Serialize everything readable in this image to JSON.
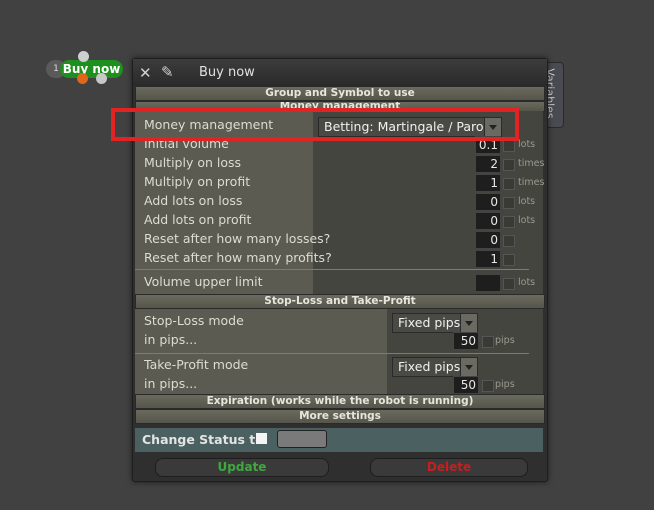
{
  "node": {
    "index": "1",
    "label": "Buy now"
  },
  "window": {
    "title": "Buy now"
  },
  "side_tab": "Variables",
  "sections": {
    "group_symbol": "Group and Symbol to use",
    "money_management": "Money management",
    "sl_tp": "Stop-Loss and Take-Profit",
    "expiration": "Expiration (works while the robot is running)",
    "more": "More settings"
  },
  "money": {
    "label": "Money management",
    "mode": "Betting: Martingale / Paroli",
    "rows": [
      {
        "label": "Initial volume",
        "value": "0.1",
        "unit": "lots"
      },
      {
        "label": "Multiply on loss",
        "value": "2",
        "unit": "times"
      },
      {
        "label": "Multiply on profit",
        "value": "1",
        "unit": "times"
      },
      {
        "label": "Add lots on loss",
        "value": "0",
        "unit": "lots"
      },
      {
        "label": "Add lots on profit",
        "value": "0",
        "unit": "lots"
      },
      {
        "label": "Reset after how many losses?",
        "value": "0",
        "unit": ""
      },
      {
        "label": "Reset after how many profits?",
        "value": "1",
        "unit": ""
      }
    ],
    "upper": {
      "label": "Volume upper limit",
      "value": "",
      "unit": "lots"
    }
  },
  "sl": {
    "mode_label": "Stop-Loss mode",
    "mode": "Fixed pips",
    "pips_label": "in pips...",
    "pips": "50",
    "unit": "pips"
  },
  "tp": {
    "mode_label": "Take-Profit mode",
    "mode": "Fixed pips",
    "pips_label": "in pips...",
    "pips": "50",
    "unit": "pips"
  },
  "status": {
    "label": "Change Status to",
    "value": ""
  },
  "buttons": {
    "update": "Update",
    "delete": "Delete"
  },
  "colors": {
    "update": "#3caa3c",
    "delete": "#c81e1e",
    "highlight": "#e32323"
  }
}
